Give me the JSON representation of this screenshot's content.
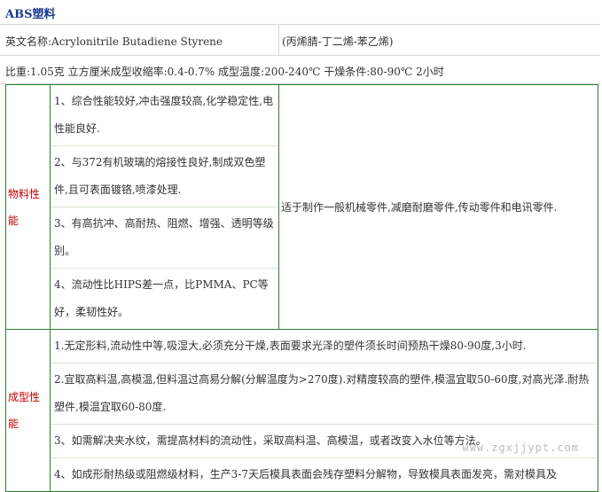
{
  "title": "ABS塑料",
  "english_name": "英文名称:Acrylonitrile Butadiene  Styrene",
  "chinese_name": "(丙烯腈-丁二烯-苯乙烯)",
  "properties_line": "比重:1.05克 立方厘米成型收缩率:0.4-0.7% 成型温度:200-240℃ 干燥条件:80-90℃ 2小时",
  "sections": [
    {
      "label_line1": "物料性",
      "label_line2": "能",
      "items": [
        "1、综合性能较好,冲击强度较高,化学稳定性,电性能良好.",
        "2、与372有机玻璃的熔接性良好,制成双色塑件,且可表面镀铬,喷漆处理.",
        "3、有高抗冲、高耐热、阻燃、增强、透明等级别。",
        "4、流动性比HIPS差一点，比PMMA、PC等好，柔韧性好。"
      ],
      "description": "适于制作一般机械零件,减磨耐磨零件,传动零件和电讯零件."
    },
    {
      "label_line1": "成型性",
      "label_line2": "能",
      "items": [
        "1.无定形料,流动性中等,吸湿大,必须充分干燥,表面要求光泽的塑件须长时间预热干燥80-90度,3小时.",
        "2.宜取高料温,高模温,但料温过高易分解(分解温度为>270度).对精度较高的塑件,模温宜取50-60度,对高光泽.耐热塑件,模温宜取60-80度.",
        "3、如需解决夹水纹，需提高材料的流动性，采取高料温、高模温，或者改变入水位等方法。",
        "4、如成形耐热级或阻燃级材料，生产3-7天后模具表面会残存塑料分解物，导致模具表面发亮，需对模具及"
      ]
    }
  ],
  "watermark": "www.zgxjjypt.com"
}
